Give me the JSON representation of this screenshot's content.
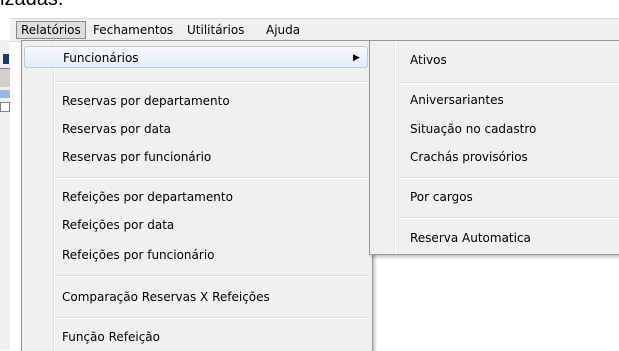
{
  "background": {
    "top_text": "izadas."
  },
  "menubar": {
    "items": [
      "Relatórios",
      "Fechamentos",
      "Utilitários",
      "Ajuda"
    ]
  },
  "primary_menu": {
    "items": [
      {
        "label": "Funcionários"
      },
      {
        "label": "Reservas por departamento"
      },
      {
        "label": "Reservas por data"
      },
      {
        "label": "Reservas por funcionário"
      },
      {
        "label": "Refeições por departamento"
      },
      {
        "label": "Refeições por data"
      },
      {
        "label": "Refeições por funcionário"
      },
      {
        "label": "Comparação Reservas X Refeições"
      },
      {
        "label": "Função Refeição"
      }
    ],
    "submenu_arrow": "▶"
  },
  "sub_menu": {
    "items": [
      {
        "label": "Ativos"
      },
      {
        "label": "Aniversariantes"
      },
      {
        "label": "Situação no cadastro"
      },
      {
        "label": "Crachás provisórios"
      },
      {
        "label": "Por cargos"
      },
      {
        "label": "Reserva Automatica"
      }
    ]
  },
  "colors": {
    "menu_bg": "#f0f0f0",
    "highlight_border": "#aecff7"
  }
}
